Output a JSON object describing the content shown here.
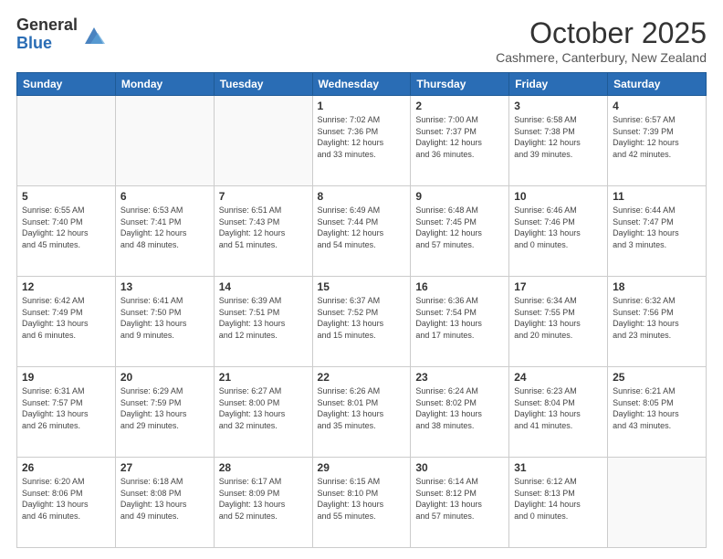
{
  "header": {
    "logo_general": "General",
    "logo_blue": "Blue",
    "month_title": "October 2025",
    "subtitle": "Cashmere, Canterbury, New Zealand"
  },
  "days_of_week": [
    "Sunday",
    "Monday",
    "Tuesday",
    "Wednesday",
    "Thursday",
    "Friday",
    "Saturday"
  ],
  "weeks": [
    [
      {
        "day": "",
        "info": ""
      },
      {
        "day": "",
        "info": ""
      },
      {
        "day": "",
        "info": ""
      },
      {
        "day": "1",
        "info": "Sunrise: 7:02 AM\nSunset: 7:36 PM\nDaylight: 12 hours\nand 33 minutes."
      },
      {
        "day": "2",
        "info": "Sunrise: 7:00 AM\nSunset: 7:37 PM\nDaylight: 12 hours\nand 36 minutes."
      },
      {
        "day": "3",
        "info": "Sunrise: 6:58 AM\nSunset: 7:38 PM\nDaylight: 12 hours\nand 39 minutes."
      },
      {
        "day": "4",
        "info": "Sunrise: 6:57 AM\nSunset: 7:39 PM\nDaylight: 12 hours\nand 42 minutes."
      }
    ],
    [
      {
        "day": "5",
        "info": "Sunrise: 6:55 AM\nSunset: 7:40 PM\nDaylight: 12 hours\nand 45 minutes."
      },
      {
        "day": "6",
        "info": "Sunrise: 6:53 AM\nSunset: 7:41 PM\nDaylight: 12 hours\nand 48 minutes."
      },
      {
        "day": "7",
        "info": "Sunrise: 6:51 AM\nSunset: 7:43 PM\nDaylight: 12 hours\nand 51 minutes."
      },
      {
        "day": "8",
        "info": "Sunrise: 6:49 AM\nSunset: 7:44 PM\nDaylight: 12 hours\nand 54 minutes."
      },
      {
        "day": "9",
        "info": "Sunrise: 6:48 AM\nSunset: 7:45 PM\nDaylight: 12 hours\nand 57 minutes."
      },
      {
        "day": "10",
        "info": "Sunrise: 6:46 AM\nSunset: 7:46 PM\nDaylight: 13 hours\nand 0 minutes."
      },
      {
        "day": "11",
        "info": "Sunrise: 6:44 AM\nSunset: 7:47 PM\nDaylight: 13 hours\nand 3 minutes."
      }
    ],
    [
      {
        "day": "12",
        "info": "Sunrise: 6:42 AM\nSunset: 7:49 PM\nDaylight: 13 hours\nand 6 minutes."
      },
      {
        "day": "13",
        "info": "Sunrise: 6:41 AM\nSunset: 7:50 PM\nDaylight: 13 hours\nand 9 minutes."
      },
      {
        "day": "14",
        "info": "Sunrise: 6:39 AM\nSunset: 7:51 PM\nDaylight: 13 hours\nand 12 minutes."
      },
      {
        "day": "15",
        "info": "Sunrise: 6:37 AM\nSunset: 7:52 PM\nDaylight: 13 hours\nand 15 minutes."
      },
      {
        "day": "16",
        "info": "Sunrise: 6:36 AM\nSunset: 7:54 PM\nDaylight: 13 hours\nand 17 minutes."
      },
      {
        "day": "17",
        "info": "Sunrise: 6:34 AM\nSunset: 7:55 PM\nDaylight: 13 hours\nand 20 minutes."
      },
      {
        "day": "18",
        "info": "Sunrise: 6:32 AM\nSunset: 7:56 PM\nDaylight: 13 hours\nand 23 minutes."
      }
    ],
    [
      {
        "day": "19",
        "info": "Sunrise: 6:31 AM\nSunset: 7:57 PM\nDaylight: 13 hours\nand 26 minutes."
      },
      {
        "day": "20",
        "info": "Sunrise: 6:29 AM\nSunset: 7:59 PM\nDaylight: 13 hours\nand 29 minutes."
      },
      {
        "day": "21",
        "info": "Sunrise: 6:27 AM\nSunset: 8:00 PM\nDaylight: 13 hours\nand 32 minutes."
      },
      {
        "day": "22",
        "info": "Sunrise: 6:26 AM\nSunset: 8:01 PM\nDaylight: 13 hours\nand 35 minutes."
      },
      {
        "day": "23",
        "info": "Sunrise: 6:24 AM\nSunset: 8:02 PM\nDaylight: 13 hours\nand 38 minutes."
      },
      {
        "day": "24",
        "info": "Sunrise: 6:23 AM\nSunset: 8:04 PM\nDaylight: 13 hours\nand 41 minutes."
      },
      {
        "day": "25",
        "info": "Sunrise: 6:21 AM\nSunset: 8:05 PM\nDaylight: 13 hours\nand 43 minutes."
      }
    ],
    [
      {
        "day": "26",
        "info": "Sunrise: 6:20 AM\nSunset: 8:06 PM\nDaylight: 13 hours\nand 46 minutes."
      },
      {
        "day": "27",
        "info": "Sunrise: 6:18 AM\nSunset: 8:08 PM\nDaylight: 13 hours\nand 49 minutes."
      },
      {
        "day": "28",
        "info": "Sunrise: 6:17 AM\nSunset: 8:09 PM\nDaylight: 13 hours\nand 52 minutes."
      },
      {
        "day": "29",
        "info": "Sunrise: 6:15 AM\nSunset: 8:10 PM\nDaylight: 13 hours\nand 55 minutes."
      },
      {
        "day": "30",
        "info": "Sunrise: 6:14 AM\nSunset: 8:12 PM\nDaylight: 13 hours\nand 57 minutes."
      },
      {
        "day": "31",
        "info": "Sunrise: 6:12 AM\nSunset: 8:13 PM\nDaylight: 14 hours\nand 0 minutes."
      },
      {
        "day": "",
        "info": ""
      }
    ]
  ]
}
